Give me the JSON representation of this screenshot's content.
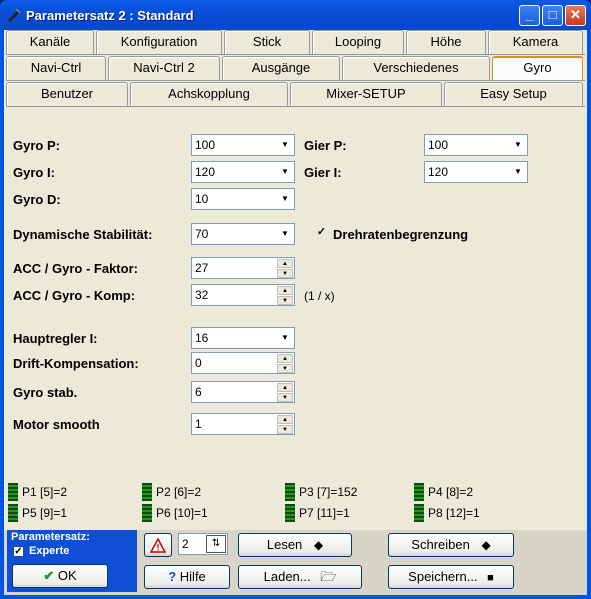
{
  "window": {
    "title": "Parametersatz 2 : Standard"
  },
  "tabs": {
    "row1": [
      "Kanäle",
      "Konfiguration",
      "Stick",
      "Looping",
      "Höhe",
      "Kamera"
    ],
    "row2": [
      "Navi-Ctrl",
      "Navi-Ctrl 2",
      "Ausgänge",
      "Verschiedenes",
      "Gyro"
    ],
    "row3": [
      "Benutzer",
      "Achskopplung",
      "Mixer-SETUP",
      "Easy Setup"
    ],
    "active": "Gyro"
  },
  "fields": {
    "gyro_p": {
      "label": "Gyro P:",
      "value": "100"
    },
    "gyro_i": {
      "label": "Gyro I:",
      "value": "120"
    },
    "gyro_d": {
      "label": "Gyro D:",
      "value": "10"
    },
    "gier_p": {
      "label": "Gier P:",
      "value": "100"
    },
    "gier_i": {
      "label": "Gier I:",
      "value": "120"
    },
    "dyn_stab": {
      "label": "Dynamische Stabilität:",
      "value": "70"
    },
    "drehraten": {
      "label": "Drehratenbegrenzung",
      "checked": true
    },
    "acc_faktor": {
      "label": "ACC / Gyro - Faktor:",
      "value": "27"
    },
    "acc_komp": {
      "label": "ACC / Gyro - Komp:",
      "value": "32",
      "unit": "(1 / x)"
    },
    "hauptregler": {
      "label": "Hauptregler I:",
      "value": "16"
    },
    "drift": {
      "label": "Drift-Kompensation:",
      "value": "0"
    },
    "gyro_stab": {
      "label": "Gyro stab.",
      "value": "6"
    },
    "motor_smooth": {
      "label": "Motor smooth",
      "value": "1"
    }
  },
  "status": [
    "P1 [5]=2",
    "P2 [6]=2",
    "P3 [7]=152",
    "P4 [8]=2",
    "P5 [9]=1",
    "P6 [10]=1",
    "P7 [11]=1",
    "P8 [12]=1"
  ],
  "bottom": {
    "parametersatz_label": "Parametersatz:",
    "experte_label": "Experte",
    "experte_checked": true,
    "set_number": "2",
    "lesen": "Lesen",
    "schreiben": "Schreiben",
    "ok": "OK",
    "hilfe": "Hilfe",
    "laden": "Laden...",
    "speichern": "Speichern..."
  },
  "colors": {
    "active_tab_border": "#e68b2c",
    "title_bar": "#0a4fd6",
    "led_green": "#1a9a1a"
  }
}
